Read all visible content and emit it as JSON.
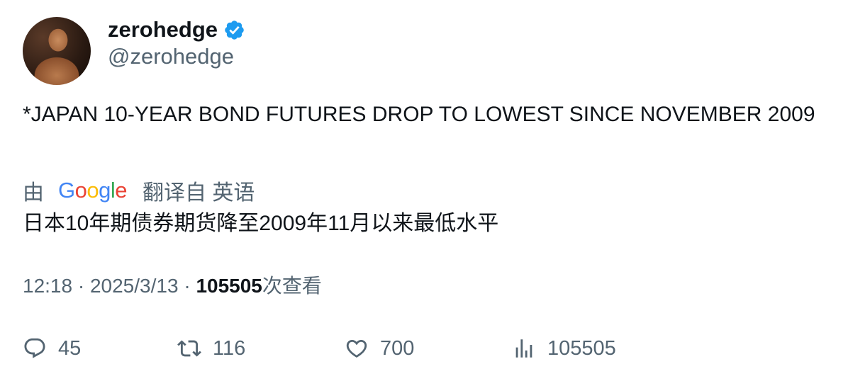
{
  "author": {
    "display_name": "zerohedge",
    "handle": "@zerohedge",
    "verified_icon": "verified-badge-icon",
    "verified_color": "#1d9bf0"
  },
  "tweet": {
    "text": "*JAPAN 10-YEAR BOND FUTURES DROP TO LOWEST SINCE NOVEMBER 2009"
  },
  "translation": {
    "prefix": "由",
    "provider": "Google",
    "suffix": "翻译自 英语",
    "text": "日本10年期债券期货降至2009年11月以来最低水平"
  },
  "meta": {
    "time": "12:18",
    "separator": "·",
    "date": "2025/3/13",
    "views_count": "105505",
    "views_label": "次查看"
  },
  "actions": {
    "replies": "45",
    "retweets": "116",
    "likes": "700",
    "views": "105505"
  },
  "colors": {
    "text_primary": "#0f1419",
    "text_secondary": "#536471",
    "accent": "#1d9bf0"
  }
}
